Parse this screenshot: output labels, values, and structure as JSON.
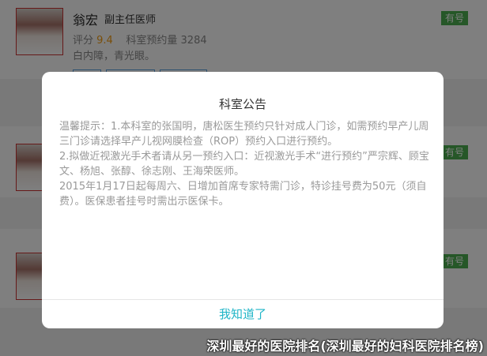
{
  "doctors": [
    {
      "name": "翁宏",
      "title": "副主任医师",
      "score_label": "评分",
      "score": "9.4",
      "booking_label": "科室预约量",
      "booking_count": "3284",
      "specialty": "白内障，青光眼。",
      "badge": "有号"
    },
    {
      "badge": "有号"
    },
    {
      "badge": "有号"
    }
  ],
  "modal": {
    "title": "科室公告",
    "paragraphs": [
      "温馨提示：1.本科室的张国明，唐松医生预约只针对成人门诊，如需预约早产儿周三门诊请选择早产儿视网膜检查（ROP）预约入口进行预约。",
      "2.拟做近视激光手术者请从另一预约入口：近视激光手术“进行预约”严宗辉、顾宝文、杨旭、张醇、徐志刚、王海荣医师。",
      "2015年1月17日起每周六、日增加首席专家特需门诊，特诊挂号费为50元（须自费）。医保患者挂号时需出示医保卡。"
    ],
    "confirm_label": "我知道了"
  },
  "caption": "深圳最好的医院排名(深圳最好的妇科医院排名榜)",
  "colors": {
    "badge": "#4caf50",
    "confirm": "#1fb5c7",
    "score": "#f39c12"
  }
}
